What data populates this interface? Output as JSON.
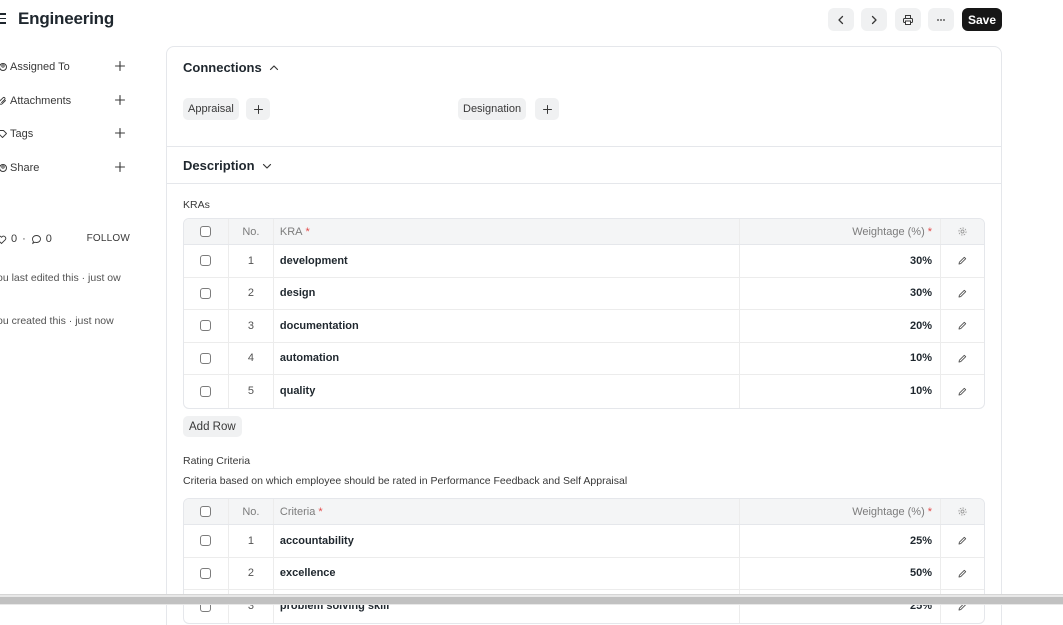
{
  "header": {
    "title": "Engineering",
    "save_label": "Save",
    "prev_icon": "chevron-left-icon",
    "next_icon": "chevron-right-icon",
    "print_icon": "printer-icon",
    "more_icon": "ellipsis-icon"
  },
  "sidebar": {
    "items": [
      {
        "label": "Assigned To",
        "icon": "assign-icon"
      },
      {
        "label": "Attachments",
        "icon": "paperclip-icon"
      },
      {
        "label": "Tags",
        "icon": "tag-icon"
      },
      {
        "label": "Share",
        "icon": "share-icon"
      }
    ],
    "likes": "0",
    "comments": "0",
    "follow_label": "FOLLOW",
    "activity": [
      "ou last edited this · just ow",
      "ou created this · just now"
    ]
  },
  "connections": {
    "title": "Connections",
    "links": [
      "Appraisal",
      "Designation"
    ]
  },
  "description": {
    "title": "Description"
  },
  "kras": {
    "label": "KRAs",
    "headers": {
      "no": "No.",
      "name": "KRA",
      "weight": "Weightage (%)"
    },
    "rows": [
      {
        "no": "1",
        "name": "development",
        "weight": "30%"
      },
      {
        "no": "2",
        "name": "design",
        "weight": "30%"
      },
      {
        "no": "3",
        "name": "documentation",
        "weight": "20%"
      },
      {
        "no": "4",
        "name": "automation",
        "weight": "10%"
      },
      {
        "no": "5",
        "name": "quality",
        "weight": "10%"
      }
    ],
    "add_row_label": "Add Row"
  },
  "rating_criteria": {
    "label": "Rating Criteria",
    "description": "Criteria based on which employee should be rated in Performance Feedback and Self Appraisal",
    "headers": {
      "no": "No.",
      "name": "Criteria",
      "weight": "Weightage (%)"
    },
    "rows": [
      {
        "no": "1",
        "name": "accountability",
        "weight": "25%"
      },
      {
        "no": "2",
        "name": "excellence",
        "weight": "50%"
      },
      {
        "no": "3",
        "name": "problem solving skill",
        "weight": "25%"
      }
    ]
  },
  "colors": {
    "primary_button": "#171717",
    "required_star": "#e24c4c",
    "border": "#e5e7eb"
  }
}
